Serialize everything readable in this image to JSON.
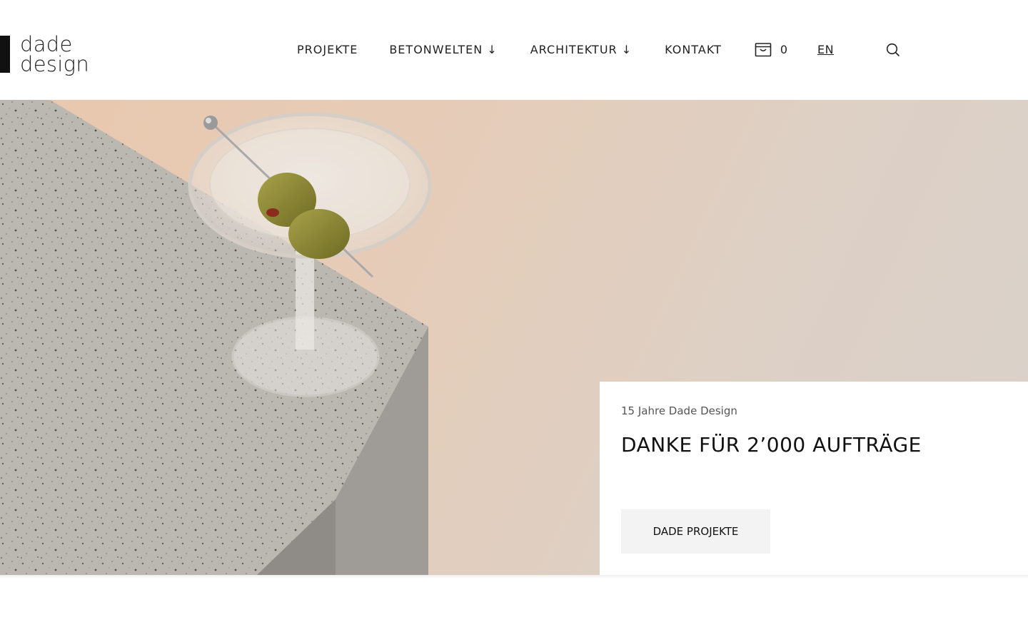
{
  "brand": {
    "line1": "dade",
    "line2": "design"
  },
  "nav": {
    "projekte": "PROJEKTE",
    "betonwelten": "BETONWELTEN ↓",
    "architektur": "ARCHITEKTUR ↓",
    "kontakt": "KONTAKT",
    "cart_count": "0",
    "language": "EN"
  },
  "icons": {
    "cart": "shopping-bag-icon",
    "search": "search-icon"
  },
  "hero": {
    "kicker": "15 Jahre Dade Design",
    "title": "DANKE FÜR 2’000 AUFTRÄGE",
    "button_label": "DADE PROJEKTE"
  },
  "colors": {
    "text": "#111111",
    "button_bg": "#f3f3f3",
    "hero_bg": "#e6ccb7"
  }
}
